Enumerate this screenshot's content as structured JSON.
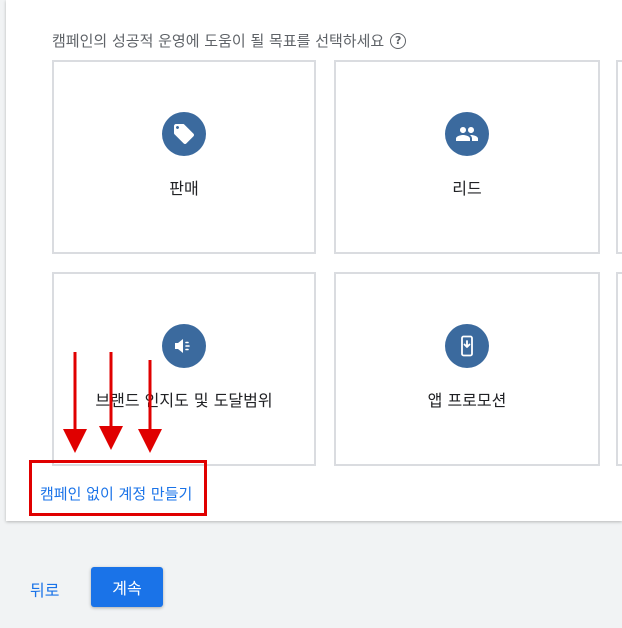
{
  "heading": "캠페인의 성공적 운영에 도움이 될 목표를 선택하세요",
  "help_icon_glyph": "?",
  "goals": [
    {
      "label": "판매",
      "icon": "sell-tag-icon"
    },
    {
      "label": "리드",
      "icon": "people-icon"
    },
    {
      "label": "브랜드 인지도 및 도달범위",
      "icon": "megaphone-icon"
    },
    {
      "label": "앱 프로모션",
      "icon": "phone-download-icon"
    }
  ],
  "create_without_campaign": "캠페인 없이 계정 만들기",
  "footer": {
    "back_label": "뒤로",
    "continue_label": "계속"
  },
  "colors": {
    "accent": "#1a73e8",
    "icon_circle": "#3b6a9e",
    "annotation_red": "#e00000"
  }
}
